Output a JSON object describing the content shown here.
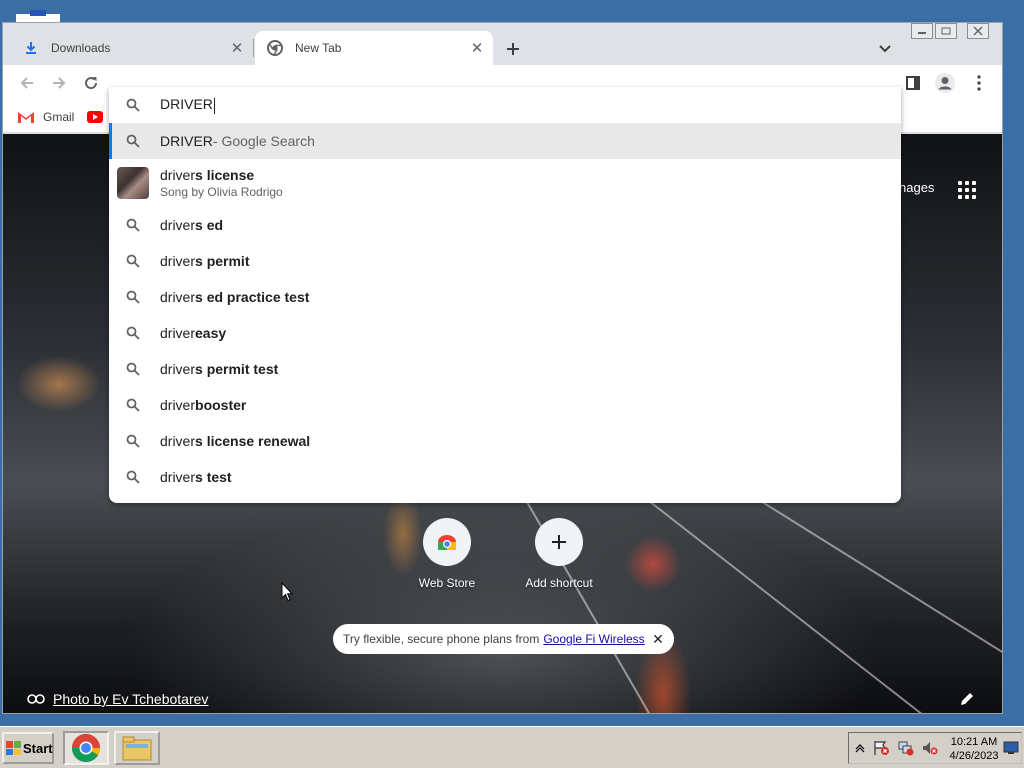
{
  "tabs": [
    {
      "label": "Downloads",
      "icon": "download-icon",
      "active": false
    },
    {
      "label": "New Tab",
      "icon": "chrome-icon",
      "active": true
    }
  ],
  "toolbar": {
    "back_icon": "back-arrow-icon",
    "forward_icon": "forward-arrow-icon",
    "reload_icon": "reload-icon"
  },
  "bookmarks": [
    {
      "label": "Gmail",
      "icon": "gmail-icon"
    },
    {
      "label": "",
      "icon": "youtube-icon"
    }
  ],
  "omnibox": {
    "query": "DRIVER",
    "suggestions": [
      {
        "typed": "DRIVER",
        "rest": "",
        "suffix": " - Google Search",
        "icon": "search-icon",
        "highlighted": true
      },
      {
        "typed": "driver",
        "rest": "s license",
        "subtitle": "Song by Olivia Rodrigo",
        "icon": "thumbnail"
      },
      {
        "typed": "driver",
        "rest": "s ed",
        "icon": "search-icon"
      },
      {
        "typed": "driver",
        "rest": "s permit",
        "icon": "search-icon"
      },
      {
        "typed": "driver",
        "rest": "s ed practice test",
        "icon": "search-icon"
      },
      {
        "typed": "driver",
        "rest": " easy",
        "icon": "search-icon"
      },
      {
        "typed": "driver",
        "rest": "s permit test",
        "icon": "search-icon"
      },
      {
        "typed": "driver",
        "rest": " booster",
        "icon": "search-icon"
      },
      {
        "typed": "driver",
        "rest": "s license renewal",
        "icon": "search-icon"
      },
      {
        "typed": "driver",
        "rest": "s test",
        "icon": "search-icon"
      }
    ]
  },
  "newtab": {
    "images_link": "nages",
    "shortcuts": [
      {
        "label": "Web Store",
        "icon": "webstore-icon"
      },
      {
        "label": "Add shortcut",
        "icon": "plus-icon"
      }
    ],
    "promo": {
      "text": "Try flexible, secure phone plans from",
      "link": "Google Fi Wireless"
    },
    "photo_credit": "Photo by Ev Tchebotarev"
  },
  "taskbar": {
    "start_label": "Start",
    "clock_time": "10:21 AM",
    "clock_date": "4/26/2023"
  },
  "colors": {
    "desktop": "#3a6ea5",
    "accent": "#1a73e8",
    "tabstrip": "#dee1e6",
    "taskbar": "#d4d0c8"
  }
}
